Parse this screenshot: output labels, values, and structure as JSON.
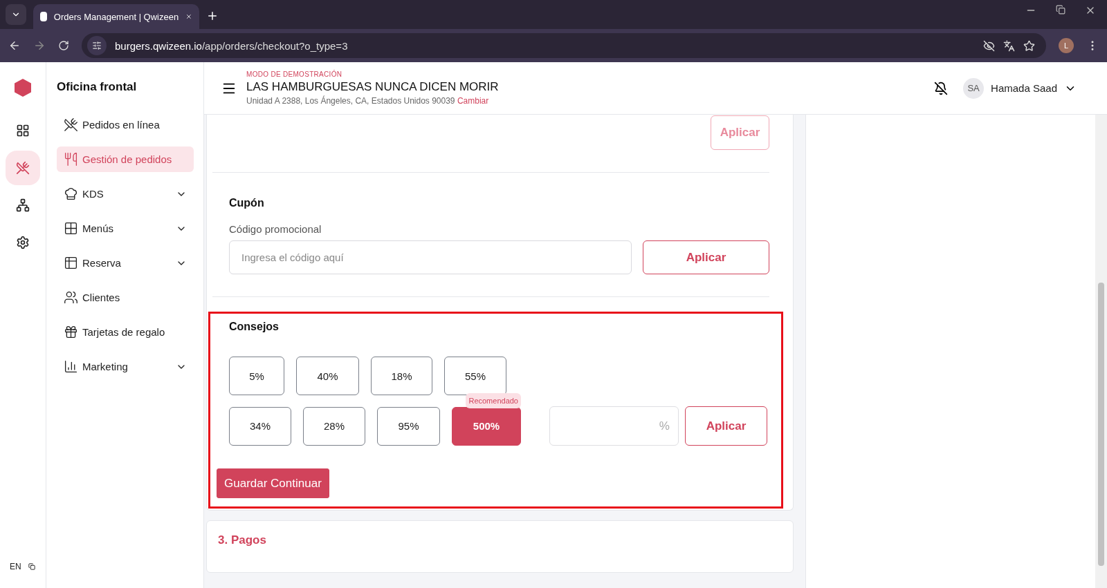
{
  "browser": {
    "tab_title": "Orders Management | Qwizeen",
    "url_host": "burgers.qwizeen.io",
    "url_path": "/app/orders/checkout?o_type=3",
    "profile_initial": "L"
  },
  "rail_items": [
    {
      "kind": "logo",
      "selected": false
    },
    {
      "kind": "dashboard",
      "selected": false
    },
    {
      "kind": "orders",
      "selected": true
    },
    {
      "kind": "network",
      "selected": false
    },
    {
      "kind": "settings",
      "selected": false
    }
  ],
  "sidebar": {
    "title": "Oficina frontal",
    "items": [
      {
        "label": "Pedidos en línea",
        "selected": false,
        "expandable": false
      },
      {
        "label": "Gestión de pedidos",
        "selected": true,
        "expandable": false
      },
      {
        "label": "KDS",
        "selected": false,
        "expandable": true
      },
      {
        "label": "Menús",
        "selected": false,
        "expandable": true
      },
      {
        "label": "Reserva",
        "selected": false,
        "expandable": true
      },
      {
        "label": "Clientes",
        "selected": false,
        "expandable": false
      },
      {
        "label": "Tarjetas de regalo",
        "selected": false,
        "expandable": false
      },
      {
        "label": "Marketing",
        "selected": false,
        "expandable": true
      }
    ]
  },
  "language": "EN",
  "header": {
    "demo_label": "MODO DE DEMOSTRACIÓN",
    "restaurant": "LAS HAMBURGUESAS NUNCA DICEN MORIR",
    "address": "Unidad A 2388, Los Ángeles, CA, Estados Unidos 90039",
    "change_link": "Cambiar",
    "user_initials": "SA",
    "user_name": "Hamada Saad"
  },
  "top_section": {
    "apply_button": "Aplicar"
  },
  "coupon": {
    "title": "Cupón",
    "field_label": "Código promocional",
    "placeholder": "Ingresa el código aquí",
    "apply_button": "Aplicar"
  },
  "tips": {
    "title": "Consejos",
    "highlighted": true,
    "rows": [
      [
        {
          "label": "5%",
          "selected": false
        },
        {
          "label": "40%",
          "selected": false
        },
        {
          "label": "18%",
          "selected": false
        },
        {
          "label": "55%",
          "selected": false
        }
      ],
      [
        {
          "label": "34%",
          "selected": false
        },
        {
          "label": "28%",
          "selected": false
        },
        {
          "label": "95%",
          "selected": false
        },
        {
          "label": "500%",
          "selected": true,
          "badge": "Recomendado"
        }
      ]
    ],
    "custom_suffix": "%",
    "apply_button": "Aplicar",
    "save_button": "Guardar Continuar"
  },
  "payments": {
    "title": "3. Pagos"
  }
}
